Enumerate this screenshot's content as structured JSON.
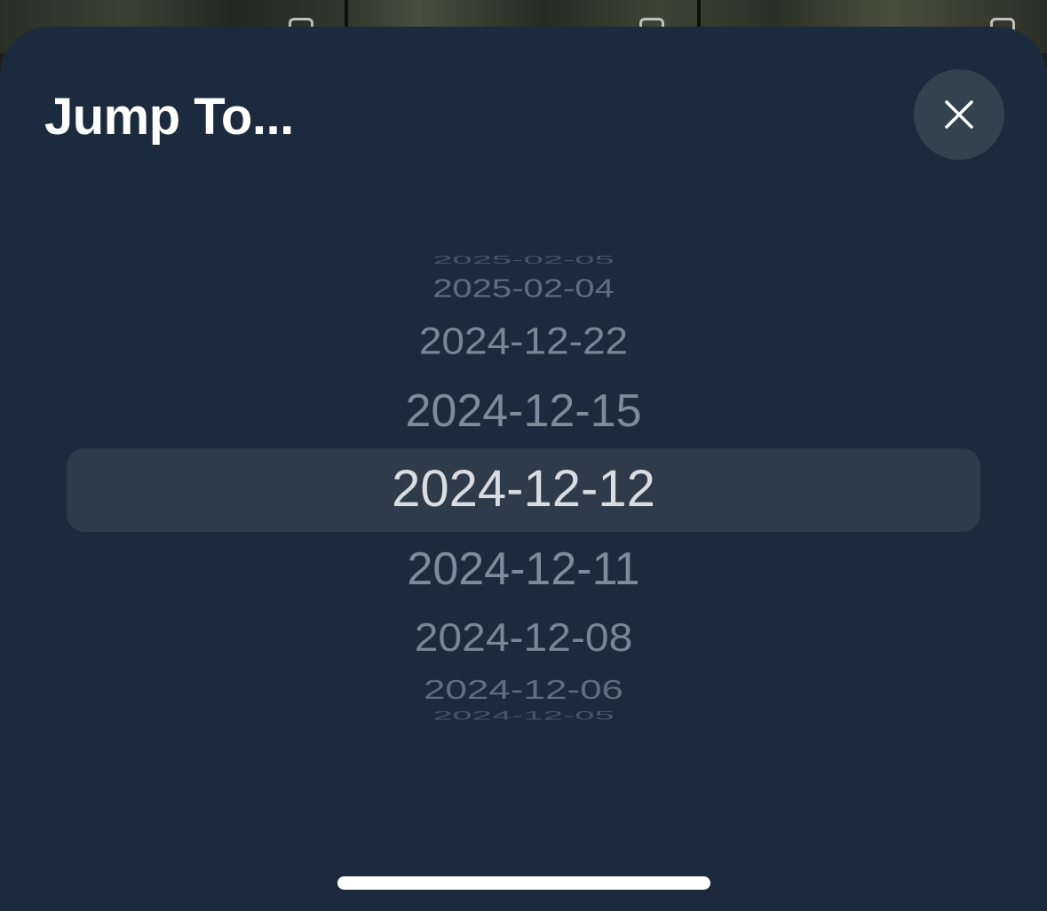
{
  "sheet": {
    "title": "Jump To...",
    "close_icon": "close-icon"
  },
  "picker": {
    "selected_index": 4,
    "dates": [
      "2025-02-05",
      "2025-02-04",
      "2024-12-22",
      "2024-12-15",
      "2024-12-12",
      "2024-12-11",
      "2024-12-08",
      "2024-12-06",
      "2024-12-05"
    ]
  },
  "colors": {
    "sheet_background": "#1b2a3c",
    "selection_highlight": "#2e3b4b",
    "selected_text": "#d9dde2",
    "unselected_text": "#7d8b9a",
    "close_button": "#33424f"
  }
}
